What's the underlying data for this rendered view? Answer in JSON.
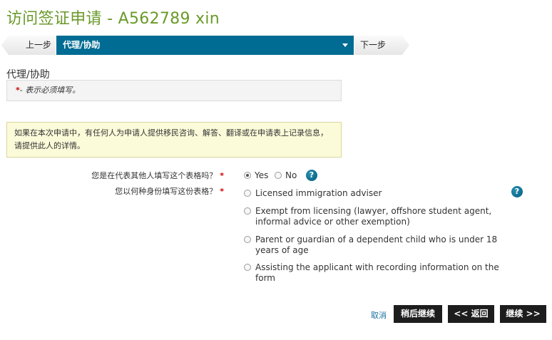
{
  "page": {
    "title": "访问签证申请 - A562789 xin"
  },
  "stepbar": {
    "prev_label": "上一步",
    "current_label": "代理/协助",
    "next_label": "下一步"
  },
  "section": {
    "title": "代理/协助",
    "required_star": "*",
    "required_text": "- 表示必须填写。"
  },
  "info": {
    "text": "如果在本次申请中，有任何人为申请人提供移民咨询、解答、翻译或在申请表上记录信息，请提供此人的详情。"
  },
  "questions": {
    "q1": {
      "label": "您是在代表其他人填写这个表格吗？",
      "star": "*",
      "options": [
        {
          "label": "Yes",
          "selected": true
        },
        {
          "label": "No",
          "selected": false
        }
      ]
    },
    "q2": {
      "label": "您以何种身份填写这份表格？",
      "star": "*",
      "options": [
        {
          "label": "Licensed immigration adviser",
          "selected": false
        },
        {
          "label": "Exempt from licensing (lawyer, offshore student agent, informal advice or other exemption)",
          "selected": false
        },
        {
          "label": "Parent or guardian of a dependent child who is under 18 years of age",
          "selected": false
        },
        {
          "label": "Assisting the applicant with recording information on the form",
          "selected": false
        }
      ]
    }
  },
  "help": {
    "glyph": "?"
  },
  "actions": {
    "cancel_label": "取消",
    "save_continue_later_label": "稍后继续",
    "back_label": "<< 返回",
    "continue_label": "继续 >>"
  },
  "colors": {
    "title_green": "#6a9a2a",
    "step_active_blue": "#006c93",
    "info_yellow": "#fbfbd9",
    "required_red": "#cc0000",
    "button_dark": "#1d1d1d"
  }
}
